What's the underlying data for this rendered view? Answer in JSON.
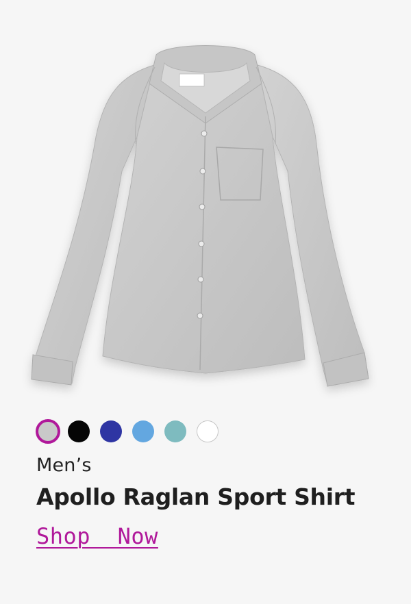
{
  "product": {
    "category": "Men’s",
    "name": "Apollo Raglan Sport Shirt",
    "cta_label": "Shop  Now",
    "image_alt_icon": "shirt-icon"
  },
  "swatches": [
    {
      "name": "Light Grey",
      "color": "#c9c9c9",
      "selected": true
    },
    {
      "name": "Black",
      "color": "#050505",
      "selected": false
    },
    {
      "name": "Royal Blue",
      "color": "#2e35a3",
      "selected": false
    },
    {
      "name": "Sky Blue",
      "color": "#63a7e0",
      "selected": false
    },
    {
      "name": "Sea Green",
      "color": "#7ebbbf",
      "selected": false
    },
    {
      "name": "White",
      "color": "#ffffff",
      "selected": false
    }
  ],
  "colors": {
    "accent": "#b0189a",
    "background": "#f6f6f6",
    "text": "#1f1f1f"
  }
}
